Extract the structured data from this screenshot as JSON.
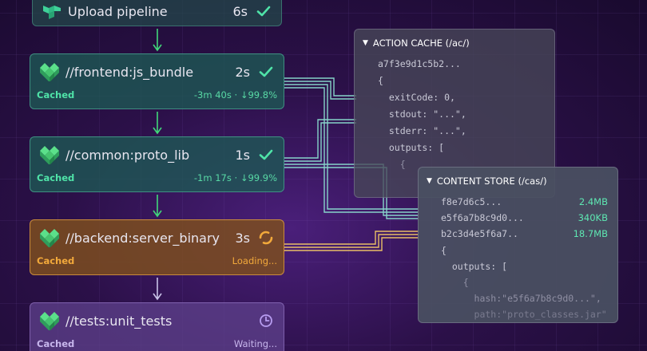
{
  "pipeline": {
    "steps": [
      {
        "name": "Upload pipeline",
        "time": "6s",
        "status": "done"
      },
      {
        "name": "//frontend:js_bundle",
        "time": "2s",
        "status": "done",
        "cache_label": "Cached",
        "detail": "-3m 40s · ↓99.8%"
      },
      {
        "name": "//common:proto_lib",
        "time": "1s",
        "status": "done",
        "cache_label": "Cached",
        "detail": "-1m 17s · ↓99.9%"
      },
      {
        "name": "//backend:server_binary",
        "time": "3s",
        "status": "loading",
        "cache_label": "Cached",
        "detail": "Loading..."
      },
      {
        "name": "//tests:unit_tests",
        "time": "",
        "status": "waiting",
        "cache_label": "Cached",
        "detail": "Waiting..."
      }
    ]
  },
  "action_cache": {
    "title": "ACTION CACHE (/ac/)",
    "lines": [
      "a7f3e9d1c5b2...",
      "{",
      "  exitCode: 0,",
      "  stdout: \"...\",",
      "  stderr: \"...\",",
      "  outputs: [",
      "    {"
    ]
  },
  "content_store": {
    "title": "CONTENT STORE (/cas/)",
    "entries": [
      {
        "hash": "f8e7d6c5...",
        "size": "2.4MB"
      },
      {
        "hash": "e5f6a7b8c9d0...",
        "size": "340KB"
      },
      {
        "hash": "b2c3d4e5f6a7..",
        "size": "18.7MB"
      }
    ],
    "lines": [
      "{",
      "  outputs: [",
      "    {",
      "      hash:\"e5f6a7b8c9d0...\",",
      "      path:\"proto_classes.jar\""
    ]
  },
  "colors": {
    "accent_green": "#4fe3a8",
    "accent_orange": "#f2a93b",
    "accent_purple": "#b79cf0"
  }
}
